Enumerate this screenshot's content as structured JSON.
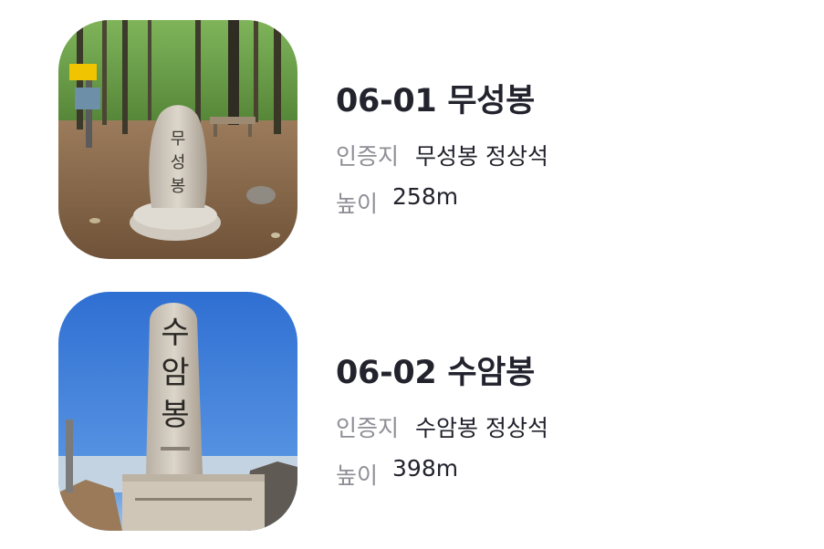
{
  "peaks": [
    {
      "title": "06-01 무성봉",
      "cert_label": "인증지",
      "cert_value": "무성봉 정상석",
      "height_label": "높이",
      "height_value": "258m",
      "photo": "summit-stone-photo",
      "stone_text": [
        "무",
        "성",
        "봉"
      ]
    },
    {
      "title": "06-02 수암봉",
      "cert_label": "인증지",
      "cert_value": "수암봉 정상석",
      "height_label": "높이",
      "height_value": "398m",
      "photo": "summit-stone-photo",
      "stone_text": [
        "수",
        "암",
        "봉"
      ]
    }
  ],
  "colors": {
    "title": "#23232e",
    "label": "#8e8e96",
    "sky": "#3f7fd6",
    "forest": "#5f9a3c",
    "ground": "#8a6a4c"
  }
}
